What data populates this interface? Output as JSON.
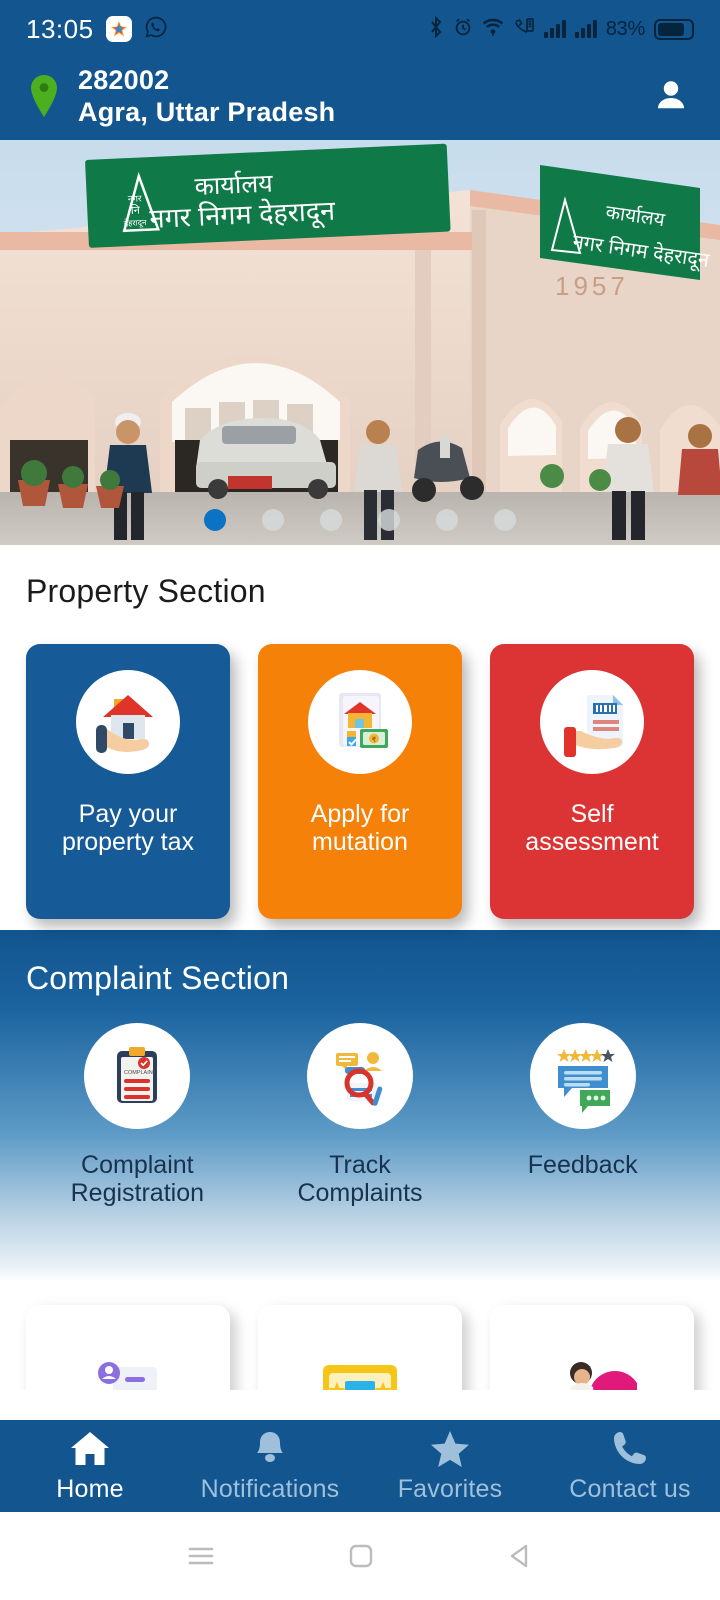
{
  "status_bar": {
    "time": "13:05",
    "left_icons": [
      "star-app-icon",
      "whatsapp-icon"
    ],
    "right_icons": [
      "bluetooth-icon",
      "alarm-icon",
      "wifi-icon",
      "vibrate-icon",
      "signal-sim1-icon",
      "signal-sim2-icon"
    ],
    "battery_percent": "83%"
  },
  "header": {
    "location_icon": "location-pin-icon",
    "pin_code": "282002",
    "city_state": "Agra, Uttar Pradesh",
    "profile_icon": "user-profile-icon",
    "background_color": "#12558f"
  },
  "banner": {
    "alt_text": "कार्यालय नगर निगम देहरादून",
    "sign_line1": "कार्यालय",
    "sign_line2": "नगर निगम देहरादून",
    "year_text": "1957",
    "dot_count": 6,
    "active_dot": 0,
    "active_dot_color": "#0b72c4"
  },
  "property_section": {
    "title": "Property Section",
    "cards": [
      {
        "label_line1": "Pay your",
        "label_line2": "property tax",
        "color": "#165a97",
        "icon": "hand-holding-house-icon"
      },
      {
        "label_line1": "Apply for",
        "label_line2": "mutation",
        "color": "#f58109",
        "icon": "document-house-money-icon"
      },
      {
        "label_line1": "Self",
        "label_line2": "assessment",
        "color": "#dc3434",
        "icon": "hand-holding-document-icon"
      }
    ]
  },
  "complaint_section": {
    "title": "Complaint Section",
    "items": [
      {
        "label_line1": "Complaint",
        "label_line2": "Registration",
        "icon": "clipboard-complaint-icon"
      },
      {
        "label_line1": "Track",
        "label_line2": "Complaints",
        "icon": "magnifier-document-icon"
      },
      {
        "label_line1": "Feedback",
        "label_line2": "",
        "icon": "chat-stars-feedback-icon"
      }
    ]
  },
  "services_section": {
    "cards": [
      {
        "icon": "user-card-icon"
      },
      {
        "icon": "star-ticket-icon"
      },
      {
        "icon": "person-pink-icon"
      }
    ]
  },
  "bottom_nav": {
    "items": [
      {
        "label": "Home",
        "icon": "home-icon",
        "active": true
      },
      {
        "label": "Notifications",
        "icon": "bell-icon",
        "active": false
      },
      {
        "label": "Favorites",
        "icon": "star-icon",
        "active": false
      },
      {
        "label": "Contact us",
        "icon": "phone-icon",
        "active": false
      }
    ],
    "active_color": "#ffffff",
    "inactive_color": "#9fc0da"
  },
  "system_bar": {
    "buttons": [
      "recents-icon",
      "home-square-icon",
      "back-icon"
    ]
  }
}
